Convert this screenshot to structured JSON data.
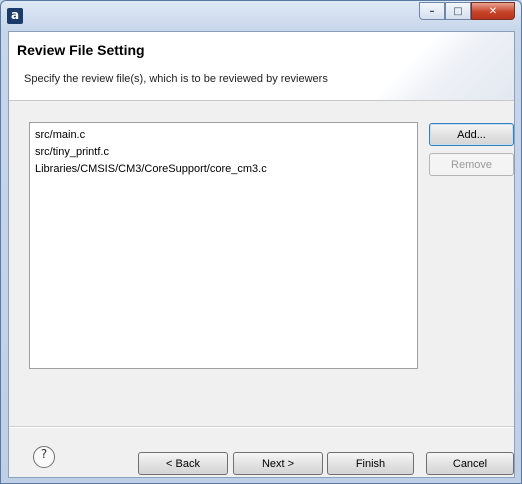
{
  "window": {
    "icon": "app-icon",
    "icon_glyph": "a",
    "controls": {
      "minimize": "–",
      "maximize": "□",
      "close": "✕"
    }
  },
  "header": {
    "title": "Review File Setting",
    "description": "Specify the review file(s), which is to be reviewed by reviewers"
  },
  "files": [
    "src/main.c",
    "src/tiny_printf.c",
    "Libraries/CMSIS/CM3/CoreSupport/core_cm3.c"
  ],
  "buttons": {
    "add": "Add...",
    "remove": "Remove",
    "back": "< Back",
    "next": "Next >",
    "finish": "Finish",
    "cancel": "Cancel",
    "help": "?"
  }
}
